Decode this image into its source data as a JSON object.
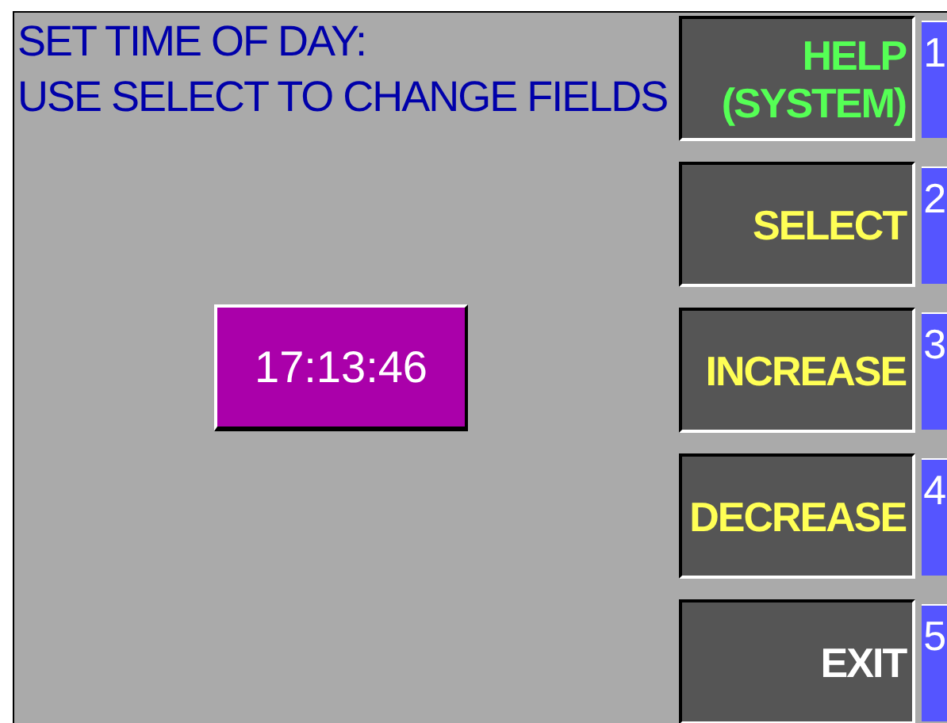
{
  "instructions": [
    "SET TIME OF DAY:",
    "USE SELECT TO CHANGE FIELDS"
  ],
  "time_field": {
    "value": "17:13:46"
  },
  "softkeys": [
    {
      "label_lines": [
        "HELP",
        "(SYSTEM)"
      ],
      "number": "1",
      "color": "#55ff55"
    },
    {
      "label_lines": [
        "SELECT"
      ],
      "number": "2",
      "color": "#ffff55"
    },
    {
      "label_lines": [
        "INCREASE"
      ],
      "number": "3",
      "color": "#ffff55"
    },
    {
      "label_lines": [
        "DECREASE"
      ],
      "number": "4",
      "color": "#ffff55"
    },
    {
      "label_lines": [
        "EXIT"
      ],
      "number": "5",
      "color": "#ffffff"
    }
  ]
}
